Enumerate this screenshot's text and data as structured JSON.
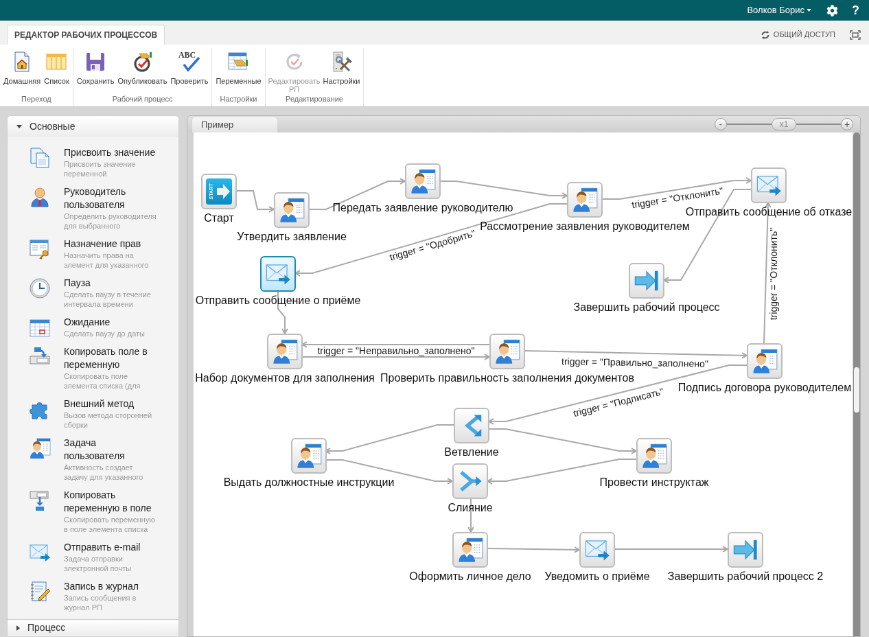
{
  "top_bar": {
    "user": "Волков Борис",
    "help": "?"
  },
  "ribbon": {
    "tabs": [
      {
        "label": "РЕДАКТОР РАБОЧИХ ПРОЦЕССОВ",
        "selected": true
      }
    ],
    "share": "ОБЩИЙ ДОСТУП",
    "groups": [
      {
        "label": "Переход",
        "buttons": [
          {
            "label": "Домашняя",
            "disabled": false
          },
          {
            "label": "Список",
            "disabled": false
          }
        ]
      },
      {
        "label": "Рабочий процесс",
        "buttons": [
          {
            "label": "Сохранить",
            "disabled": false
          },
          {
            "label": "Опубликовать",
            "disabled": false
          },
          {
            "label": "Проверить",
            "icon_text": "ABC",
            "disabled": false
          }
        ]
      },
      {
        "label": "Настройки",
        "buttons": [
          {
            "label": "Переменные",
            "disabled": false
          }
        ]
      },
      {
        "label": "Редактирование",
        "buttons": [
          {
            "label": "Редактировать РП",
            "disabled": true
          },
          {
            "label": "Настройки",
            "disabled": false
          }
        ]
      }
    ]
  },
  "toolbox": {
    "sections": [
      {
        "title": "Основные",
        "expanded": true,
        "items": [
          {
            "title": "Присвоить значение",
            "description": "Присвоить значение переменной"
          },
          {
            "title": "Руководитель пользователя",
            "description": "Определить руководителя для выбранного"
          },
          {
            "title": "Назначение прав",
            "description": "Назначить права на элемент для указанного"
          },
          {
            "title": "Пауза",
            "description": "Сделать паузу в течение интервала времени"
          },
          {
            "title": "Ожидание",
            "description": "Сделать паузу до даты"
          },
          {
            "title": "Копировать поле в переменную",
            "description": "Скопировать поле элемента списка (для"
          },
          {
            "title": "Внешний метод",
            "description": "Вызов метода сторонней сборки"
          },
          {
            "title": "Задача пользователя",
            "description": "Активность создает задачу для указанного"
          },
          {
            "title": "Копировать переменную в поле",
            "description": "Скопировать переменную в поле элемента списка"
          },
          {
            "title": "Отправить e-mail",
            "description": "Задача отправки электронной почты"
          },
          {
            "title": "Запись в журнал",
            "description": "Запись сообщения в журнал РП"
          }
        ]
      },
      {
        "title": "Процесс",
        "expanded": false
      }
    ]
  },
  "designer": {
    "tabs": [
      {
        "label": "Пример",
        "selected": true
      }
    ],
    "zoom": {
      "minus": "-",
      "reading": "x1",
      "plus": "+",
      "level": 0.5
    },
    "nodes": [
      {
        "label": "Старт",
        "kind": "start",
        "icon_text": "START",
        "selected": false
      },
      {
        "label": "Утвердить заявление",
        "kind": "task",
        "selected": false
      },
      {
        "label": "Передать заявление руководителю",
        "kind": "task",
        "selected": false
      },
      {
        "label": "Рассмотрение заявления руководителем",
        "kind": "task",
        "selected": false
      },
      {
        "label": "Отправить сообщение об отказе",
        "kind": "email",
        "selected": false
      },
      {
        "label": "Отправить сообщение о приёме",
        "kind": "email",
        "selected": true
      },
      {
        "label": "Завершить рабочий процесс",
        "kind": "end",
        "selected": false
      },
      {
        "label": "Набор документов для заполнения",
        "kind": "task",
        "selected": false
      },
      {
        "label": "Проверить правильность заполнения документов",
        "kind": "task",
        "selected": false
      },
      {
        "label": "Подпись договора руководителем",
        "kind": "task",
        "selected": false
      },
      {
        "label": "Ветвление",
        "kind": "branch",
        "selected": false
      },
      {
        "label": "Выдать должностные инструкции",
        "kind": "task",
        "selected": false
      },
      {
        "label": "Провести инструктаж",
        "kind": "task",
        "selected": false
      },
      {
        "label": "Слияние",
        "kind": "merge",
        "selected": false
      },
      {
        "label": "Оформить личное дело",
        "kind": "task",
        "selected": false
      },
      {
        "label": "Уведомить о приёме",
        "kind": "email",
        "selected": false
      },
      {
        "label": "Завершить рабочий процесс 2",
        "kind": "end",
        "selected": false
      }
    ],
    "transition_labels": [
      "trigger = \"Отклонить\"",
      "trigger = \"Одобрить\"",
      "trigger = \"Неправильно_заполнено\"",
      "trigger = \"Правильно_заполнено\"",
      "trigger = \"Отклонить\"",
      "trigger = \"Подписать\""
    ]
  }
}
